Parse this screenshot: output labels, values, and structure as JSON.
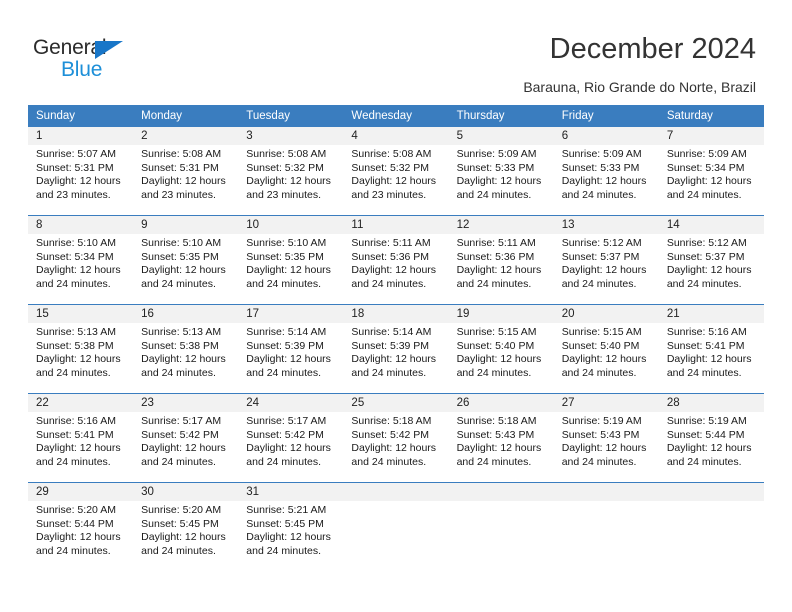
{
  "brand": {
    "name_part1": "General",
    "name_part2": "Blue",
    "color_dark": "#2b2b2b",
    "color_blue": "#1d8fd8",
    "triangle_color": "#1876c8"
  },
  "header": {
    "title": "December 2024",
    "subtitle": "Barauna, Rio Grande do Norte, Brazil",
    "accent_color": "#3a7dbf",
    "header_text_color": "#ffffff",
    "daynum_band_color": "#f2f2f2"
  },
  "weekday_headers": [
    "Sunday",
    "Monday",
    "Tuesday",
    "Wednesday",
    "Thursday",
    "Friday",
    "Saturday"
  ],
  "weeks": [
    {
      "days": [
        {
          "day": "1",
          "sunrise": "Sunrise: 5:07 AM",
          "sunset": "Sunset: 5:31 PM",
          "daylight_line1": "Daylight: 12 hours",
          "daylight_line2": "and 23 minutes."
        },
        {
          "day": "2",
          "sunrise": "Sunrise: 5:08 AM",
          "sunset": "Sunset: 5:31 PM",
          "daylight_line1": "Daylight: 12 hours",
          "daylight_line2": "and 23 minutes."
        },
        {
          "day": "3",
          "sunrise": "Sunrise: 5:08 AM",
          "sunset": "Sunset: 5:32 PM",
          "daylight_line1": "Daylight: 12 hours",
          "daylight_line2": "and 23 minutes."
        },
        {
          "day": "4",
          "sunrise": "Sunrise: 5:08 AM",
          "sunset": "Sunset: 5:32 PM",
          "daylight_line1": "Daylight: 12 hours",
          "daylight_line2": "and 23 minutes."
        },
        {
          "day": "5",
          "sunrise": "Sunrise: 5:09 AM",
          "sunset": "Sunset: 5:33 PM",
          "daylight_line1": "Daylight: 12 hours",
          "daylight_line2": "and 24 minutes."
        },
        {
          "day": "6",
          "sunrise": "Sunrise: 5:09 AM",
          "sunset": "Sunset: 5:33 PM",
          "daylight_line1": "Daylight: 12 hours",
          "daylight_line2": "and 24 minutes."
        },
        {
          "day": "7",
          "sunrise": "Sunrise: 5:09 AM",
          "sunset": "Sunset: 5:34 PM",
          "daylight_line1": "Daylight: 12 hours",
          "daylight_line2": "and 24 minutes."
        }
      ]
    },
    {
      "days": [
        {
          "day": "8",
          "sunrise": "Sunrise: 5:10 AM",
          "sunset": "Sunset: 5:34 PM",
          "daylight_line1": "Daylight: 12 hours",
          "daylight_line2": "and 24 minutes."
        },
        {
          "day": "9",
          "sunrise": "Sunrise: 5:10 AM",
          "sunset": "Sunset: 5:35 PM",
          "daylight_line1": "Daylight: 12 hours",
          "daylight_line2": "and 24 minutes."
        },
        {
          "day": "10",
          "sunrise": "Sunrise: 5:10 AM",
          "sunset": "Sunset: 5:35 PM",
          "daylight_line1": "Daylight: 12 hours",
          "daylight_line2": "and 24 minutes."
        },
        {
          "day": "11",
          "sunrise": "Sunrise: 5:11 AM",
          "sunset": "Sunset: 5:36 PM",
          "daylight_line1": "Daylight: 12 hours",
          "daylight_line2": "and 24 minutes."
        },
        {
          "day": "12",
          "sunrise": "Sunrise: 5:11 AM",
          "sunset": "Sunset: 5:36 PM",
          "daylight_line1": "Daylight: 12 hours",
          "daylight_line2": "and 24 minutes."
        },
        {
          "day": "13",
          "sunrise": "Sunrise: 5:12 AM",
          "sunset": "Sunset: 5:37 PM",
          "daylight_line1": "Daylight: 12 hours",
          "daylight_line2": "and 24 minutes."
        },
        {
          "day": "14",
          "sunrise": "Sunrise: 5:12 AM",
          "sunset": "Sunset: 5:37 PM",
          "daylight_line1": "Daylight: 12 hours",
          "daylight_line2": "and 24 minutes."
        }
      ]
    },
    {
      "days": [
        {
          "day": "15",
          "sunrise": "Sunrise: 5:13 AM",
          "sunset": "Sunset: 5:38 PM",
          "daylight_line1": "Daylight: 12 hours",
          "daylight_line2": "and 24 minutes."
        },
        {
          "day": "16",
          "sunrise": "Sunrise: 5:13 AM",
          "sunset": "Sunset: 5:38 PM",
          "daylight_line1": "Daylight: 12 hours",
          "daylight_line2": "and 24 minutes."
        },
        {
          "day": "17",
          "sunrise": "Sunrise: 5:14 AM",
          "sunset": "Sunset: 5:39 PM",
          "daylight_line1": "Daylight: 12 hours",
          "daylight_line2": "and 24 minutes."
        },
        {
          "day": "18",
          "sunrise": "Sunrise: 5:14 AM",
          "sunset": "Sunset: 5:39 PM",
          "daylight_line1": "Daylight: 12 hours",
          "daylight_line2": "and 24 minutes."
        },
        {
          "day": "19",
          "sunrise": "Sunrise: 5:15 AM",
          "sunset": "Sunset: 5:40 PM",
          "daylight_line1": "Daylight: 12 hours",
          "daylight_line2": "and 24 minutes."
        },
        {
          "day": "20",
          "sunrise": "Sunrise: 5:15 AM",
          "sunset": "Sunset: 5:40 PM",
          "daylight_line1": "Daylight: 12 hours",
          "daylight_line2": "and 24 minutes."
        },
        {
          "day": "21",
          "sunrise": "Sunrise: 5:16 AM",
          "sunset": "Sunset: 5:41 PM",
          "daylight_line1": "Daylight: 12 hours",
          "daylight_line2": "and 24 minutes."
        }
      ]
    },
    {
      "days": [
        {
          "day": "22",
          "sunrise": "Sunrise: 5:16 AM",
          "sunset": "Sunset: 5:41 PM",
          "daylight_line1": "Daylight: 12 hours",
          "daylight_line2": "and 24 minutes."
        },
        {
          "day": "23",
          "sunrise": "Sunrise: 5:17 AM",
          "sunset": "Sunset: 5:42 PM",
          "daylight_line1": "Daylight: 12 hours",
          "daylight_line2": "and 24 minutes."
        },
        {
          "day": "24",
          "sunrise": "Sunrise: 5:17 AM",
          "sunset": "Sunset: 5:42 PM",
          "daylight_line1": "Daylight: 12 hours",
          "daylight_line2": "and 24 minutes."
        },
        {
          "day": "25",
          "sunrise": "Sunrise: 5:18 AM",
          "sunset": "Sunset: 5:42 PM",
          "daylight_line1": "Daylight: 12 hours",
          "daylight_line2": "and 24 minutes."
        },
        {
          "day": "26",
          "sunrise": "Sunrise: 5:18 AM",
          "sunset": "Sunset: 5:43 PM",
          "daylight_line1": "Daylight: 12 hours",
          "daylight_line2": "and 24 minutes."
        },
        {
          "day": "27",
          "sunrise": "Sunrise: 5:19 AM",
          "sunset": "Sunset: 5:43 PM",
          "daylight_line1": "Daylight: 12 hours",
          "daylight_line2": "and 24 minutes."
        },
        {
          "day": "28",
          "sunrise": "Sunrise: 5:19 AM",
          "sunset": "Sunset: 5:44 PM",
          "daylight_line1": "Daylight: 12 hours",
          "daylight_line2": "and 24 minutes."
        }
      ]
    },
    {
      "days": [
        {
          "day": "29",
          "sunrise": "Sunrise: 5:20 AM",
          "sunset": "Sunset: 5:44 PM",
          "daylight_line1": "Daylight: 12 hours",
          "daylight_line2": "and 24 minutes."
        },
        {
          "day": "30",
          "sunrise": "Sunrise: 5:20 AM",
          "sunset": "Sunset: 5:45 PM",
          "daylight_line1": "Daylight: 12 hours",
          "daylight_line2": "and 24 minutes."
        },
        {
          "day": "31",
          "sunrise": "Sunrise: 5:21 AM",
          "sunset": "Sunset: 5:45 PM",
          "daylight_line1": "Daylight: 12 hours",
          "daylight_line2": "and 24 minutes."
        },
        {
          "day": "",
          "sunrise": "",
          "sunset": "",
          "daylight_line1": "",
          "daylight_line2": ""
        },
        {
          "day": "",
          "sunrise": "",
          "sunset": "",
          "daylight_line1": "",
          "daylight_line2": ""
        },
        {
          "day": "",
          "sunrise": "",
          "sunset": "",
          "daylight_line1": "",
          "daylight_line2": ""
        },
        {
          "day": "",
          "sunrise": "",
          "sunset": "",
          "daylight_line1": "",
          "daylight_line2": ""
        }
      ]
    }
  ]
}
